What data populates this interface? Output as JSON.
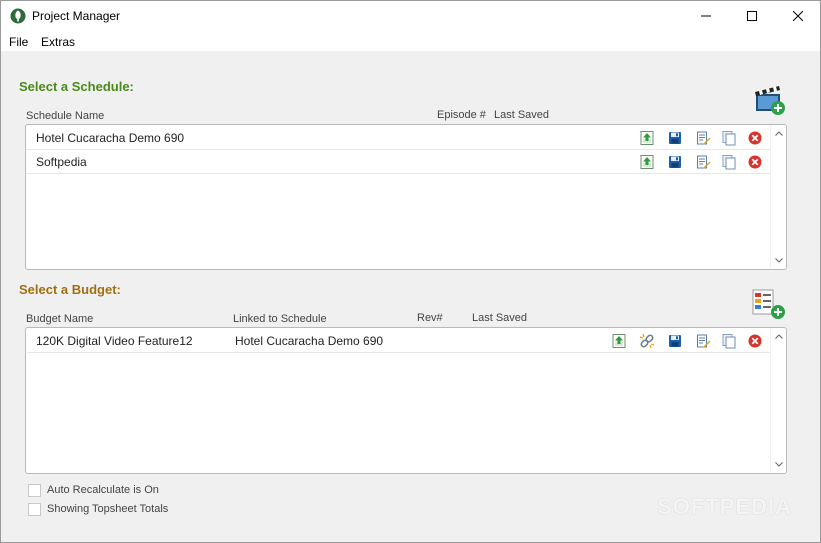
{
  "window": {
    "title": "Project Manager"
  },
  "menu": {
    "file": "File",
    "extras": "Extras"
  },
  "schedule": {
    "title": "Select a Schedule:",
    "title_color": "#4a8a1c",
    "columns": {
      "name": "Schedule Name",
      "episode": "Episode #",
      "saved": "Last Saved"
    },
    "rows": [
      {
        "name": "Hotel Cucaracha Demo 690",
        "episode": "",
        "saved": ""
      },
      {
        "name": "Softpedia",
        "episode": "",
        "saved": ""
      }
    ]
  },
  "budget": {
    "title": "Select a Budget:",
    "title_color": "#a0700f",
    "columns": {
      "name": "Budget Name",
      "linked": "Linked to Schedule",
      "rev": "Rev#",
      "saved": "Last Saved"
    },
    "rows": [
      {
        "name": "120K Digital Video Feature12",
        "linked": "Hotel Cucaracha Demo 690",
        "rev": "",
        "saved": ""
      }
    ]
  },
  "options": {
    "auto_recalc": {
      "label": "Auto Recalculate is On",
      "checked": false
    },
    "topsheet": {
      "label": "Showing Topsheet Totals",
      "checked": false
    }
  },
  "watermark": "SOFTPEDIA"
}
